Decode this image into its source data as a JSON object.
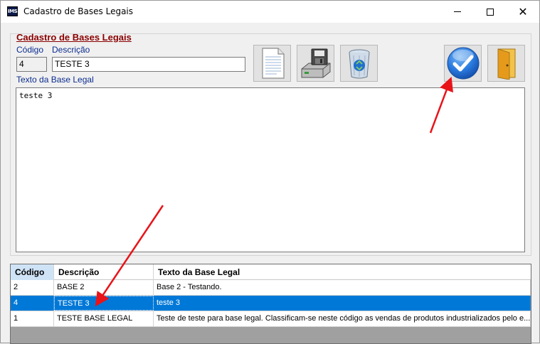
{
  "window": {
    "title": "Cadastro de Bases Legais",
    "icon_text": "IMS",
    "controls": [
      "minimize-icon",
      "maximize-icon",
      "close-icon"
    ]
  },
  "form": {
    "title": "Cadastro de Bases Legais",
    "codigo_label": "Código",
    "descricao_label": "Descrição",
    "texto_label": "Texto da Base Legal",
    "codigo_value": "4",
    "descricao_value": "TESTE 3",
    "texto_value": "teste 3"
  },
  "toolbar": {
    "buttons": [
      {
        "name": "new",
        "icon": "document-icon"
      },
      {
        "name": "save",
        "icon": "save-drive-icon"
      },
      {
        "name": "delete",
        "icon": "recycle-bin-icon"
      },
      {
        "name": "confirm",
        "icon": "checkmark-icon"
      },
      {
        "name": "exit",
        "icon": "door-exit-icon"
      }
    ]
  },
  "grid": {
    "columns": [
      "Código",
      "Descrição",
      "Texto da Base Legal"
    ],
    "rows": [
      {
        "codigo": "2",
        "descricao": "BASE 2",
        "texto": "Base 2 - Testando."
      },
      {
        "codigo": "4",
        "descricao": "TESTE 3",
        "texto": "teste 3",
        "selected": true
      },
      {
        "codigo": "1",
        "descricao": "TESTE BASE LEGAL",
        "texto": "Teste de teste para base legal. Classificam-se neste código as vendas de produtos industrializados pelo e..."
      }
    ]
  },
  "colors": {
    "form_title": "#8b0000",
    "label": "#0b2c8f",
    "selection": "#0078d7",
    "annotation_arrow": "#e8141a"
  }
}
